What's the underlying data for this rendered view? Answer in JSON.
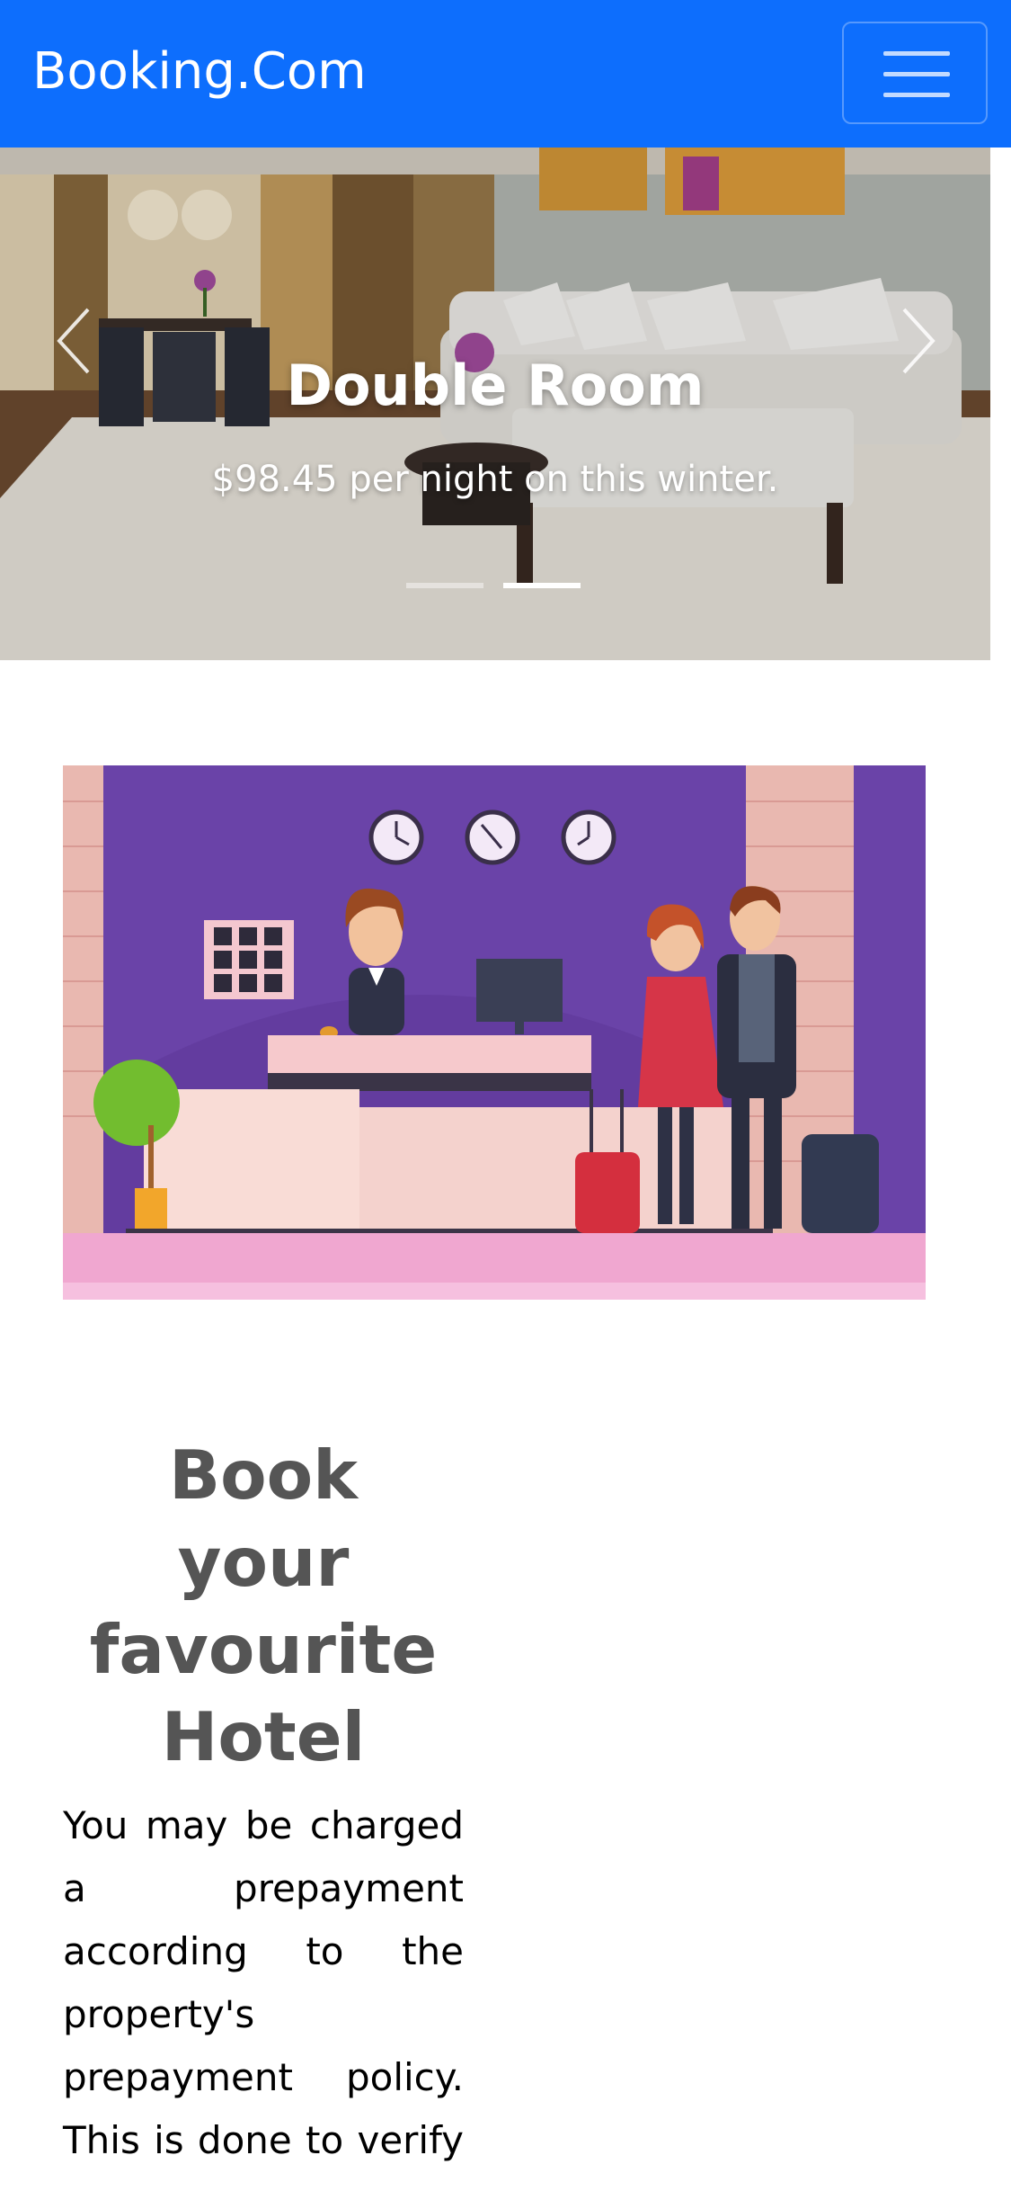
{
  "navbar": {
    "brand": "Booking.Com",
    "toggler_icon": "hamburger-icon",
    "color": "#0d6efd"
  },
  "carousel": {
    "slide_title": "Double Room",
    "slide_text": "$98.45 per night on this winter.",
    "slide_count": 2,
    "active_index": 1,
    "prev_icon": "chevron-left-icon",
    "next_icon": "chevron-right-icon"
  },
  "illustration": {
    "subject": "hotel-reception-illustration"
  },
  "intro": {
    "heading": "Book\nyour\nfavourite\nHotel",
    "body": "You may be charged\na prepayment\naccording to the\nproperty's\nprepayment policy.\nThis is done to verify"
  }
}
